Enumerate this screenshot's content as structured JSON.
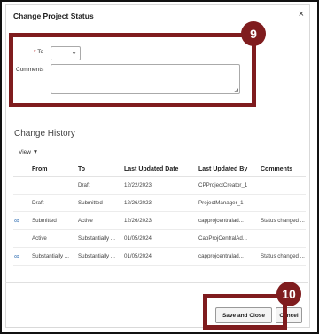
{
  "dialog": {
    "title": "Change Project Status",
    "close_glyph": "×"
  },
  "form": {
    "to_label": "To",
    "required_mark": "*",
    "to_value": "",
    "comments_label": "Comments",
    "comments_value": ""
  },
  "callouts": {
    "first": "9",
    "second": "10"
  },
  "history": {
    "title": "Change History",
    "view_label": "View ▼",
    "columns": [
      "From",
      "To",
      "Last Updated Date",
      "Last Updated By",
      "Comments"
    ],
    "rows": [
      {
        "icon": "",
        "from": "",
        "to": "Draft",
        "date": "12/22/2023",
        "by": "CPProjectCreator_1",
        "comments": ""
      },
      {
        "icon": "",
        "from": "Draft",
        "to": "Submitted",
        "date": "12/26/2023",
        "by": "ProjectManager_1",
        "comments": ""
      },
      {
        "icon": "∞",
        "from": "Submitted",
        "to": "Active",
        "date": "12/26/2023",
        "by": "capprojcentralad...",
        "comments": "Status changed ..."
      },
      {
        "icon": "",
        "from": "Active",
        "to": "Substantially ...",
        "date": "01/05/2024",
        "by": "CapProjCentralAd...",
        "comments": ""
      },
      {
        "icon": "∞",
        "from": "Substantially ...",
        "to": "Substantially ...",
        "date": "01/05/2024",
        "by": "capprojcentralad...",
        "comments": "Status changed ..."
      }
    ]
  },
  "footer": {
    "save_close_label": "Save and Close",
    "cancel_label": "Cancel"
  }
}
